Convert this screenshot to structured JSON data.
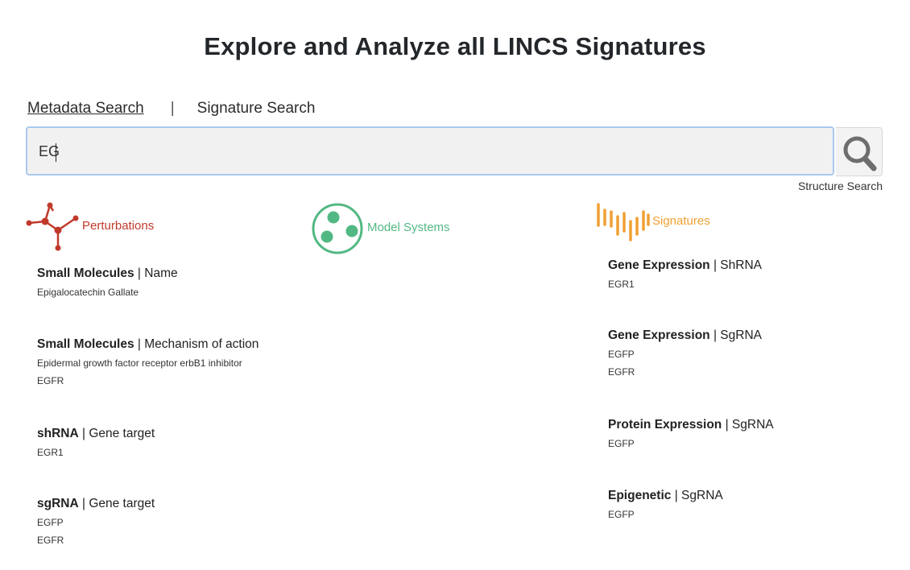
{
  "page": {
    "title": "Explore and Analyze all LINCS Signatures"
  },
  "tabs": {
    "metadata": "Metadata Search",
    "separator": "|",
    "signature": "Signature Search"
  },
  "search": {
    "value": "EG",
    "placeholder": "",
    "structure_link": "Structure Search",
    "button_icon": "search-icon"
  },
  "categories": {
    "perturbations": {
      "label": "Perturbations",
      "color": "#c0392b",
      "icon": "molecule-icon"
    },
    "model_systems": {
      "label": "Model Systems",
      "color": "#52b883",
      "icon": "cells-icon"
    },
    "signatures": {
      "label": "Signatures",
      "color": "#f0a033",
      "icon": "signature-bars-icon"
    }
  },
  "results": {
    "left": [
      {
        "type": "Small Molecules",
        "field": "Name",
        "items": [
          "Epigalocatechin Gallate"
        ]
      },
      {
        "type": "Small Molecules",
        "field": "Mechanism of action",
        "items": [
          "Epidermal growth factor receptor erbB1 inhibitor",
          "EGFR"
        ]
      },
      {
        "type": "shRNA",
        "field": "Gene target",
        "items": [
          "EGR1"
        ]
      },
      {
        "type": "sgRNA",
        "field": "Gene target",
        "items": [
          "EGFP",
          "EGFR"
        ]
      }
    ],
    "right": [
      {
        "type": "Gene Expression",
        "field": "ShRNA",
        "items": [
          "EGR1"
        ]
      },
      {
        "type": "Gene Expression",
        "field": "SgRNA",
        "items": [
          "EGFP",
          "EGFR"
        ]
      },
      {
        "type": "Protein Expression",
        "field": "SgRNA",
        "items": [
          "EGFP"
        ]
      },
      {
        "type": "Epigenetic",
        "field": "SgRNA",
        "items": [
          "EGFP"
        ]
      }
    ],
    "separator": "|"
  }
}
